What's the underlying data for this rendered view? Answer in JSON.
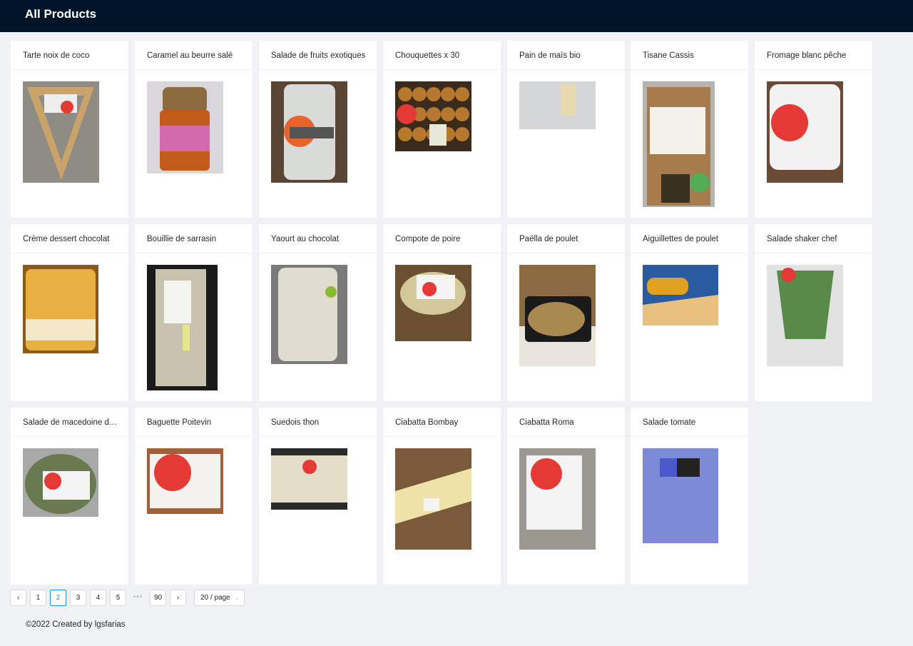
{
  "header": {
    "title": "All Products"
  },
  "products": [
    {
      "name": "Tarte noix de coco",
      "img": "triangle-pack",
      "bg": "#8f8c86"
    },
    {
      "name": "Caramel au beurre salé",
      "img": "jar",
      "bg": "#d9d6dc"
    },
    {
      "name": "Salade de fruits exotiques",
      "img": "cup-orange",
      "bg": "#5a4433"
    },
    {
      "name": "Chouquettes x 30",
      "img": "pastry-box",
      "bg": "#3a2b1c"
    },
    {
      "name": "Pain de maïs bio",
      "img": "bread-bag",
      "bg": "#c8c8c8"
    },
    {
      "name": "Tisane Cassis",
      "img": "tea-bag",
      "bg": "#b8b4ac"
    },
    {
      "name": "Fromage blanc pêche",
      "img": "crous-cup",
      "bg": "#6a4a35"
    },
    {
      "name": "Crème dessert chocolat",
      "img": "dessert-jar",
      "bg": "#8a5a1a"
    },
    {
      "name": "Bouillie de sarrasin",
      "img": "wrapped-bar",
      "bg": "#1a1a1a"
    },
    {
      "name": "Yaourt au chocolat",
      "img": "yogurt",
      "bg": "#7a7a7a"
    },
    {
      "name": "Compote de poire",
      "img": "compote",
      "bg": "#6a5030"
    },
    {
      "name": "Paëlla de poulet",
      "img": "paella",
      "bg": "#8a6a40"
    },
    {
      "name": "Aiguillettes de poulet",
      "img": "gaulois",
      "bg": "#4a6a9a"
    },
    {
      "name": "Salade shaker chef",
      "img": "shaker",
      "bg": "#d8d8d8"
    },
    {
      "name": "Salade de macedoine de...",
      "img": "salad-bowl",
      "bg": "#a8a8a8"
    },
    {
      "name": "Baguette Poitevin",
      "img": "baguette",
      "bg": "#a0603a"
    },
    {
      "name": "Suedois thon",
      "img": "sandwich",
      "bg": "#2a2a2a"
    },
    {
      "name": "Ciabatta Bombay",
      "img": "wrap",
      "bg": "#7a5a3a"
    },
    {
      "name": "Ciabatta Roma",
      "img": "ciabatta",
      "bg": "#9a9890"
    },
    {
      "name": "Salade tomate",
      "img": "crous-label",
      "bg": "#6a7acc"
    }
  ],
  "pagination": {
    "prev_icon": "‹",
    "next_icon": "›",
    "pages": [
      "1",
      "2",
      "3",
      "4",
      "5"
    ],
    "current": "2",
    "ellipsis": "•••",
    "last": "90",
    "page_size": "20 / page",
    "size_icon": "chevron-down-icon"
  },
  "footer": {
    "text": "©2022 Created by lgsfarias"
  },
  "colors": {
    "header": "#001529",
    "background": "#f0f2f5",
    "accent": "#1890ff",
    "crous_red": "#e53935"
  }
}
